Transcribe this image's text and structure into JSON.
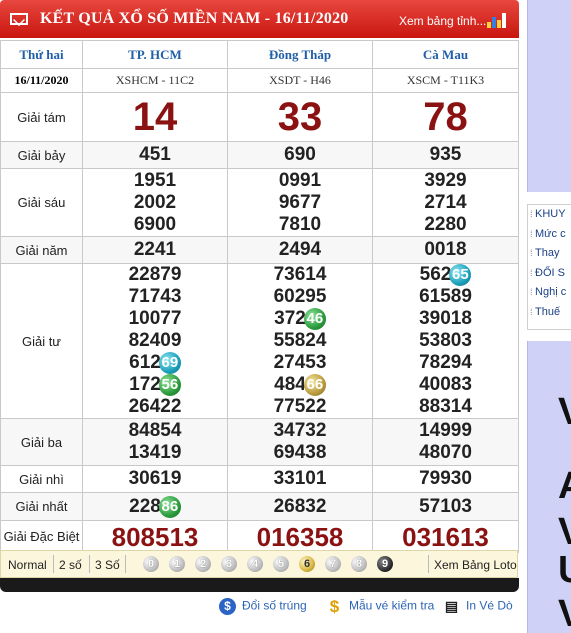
{
  "header": {
    "title": "KẾT QUẢ XỔ SỐ MIỀN NAM - 16/11/2020",
    "view_link": "Xem bảng tỉnh...",
    "mail_icon": "envelope-icon",
    "chart_icon": "bar-chart-icon",
    "colors": {
      "bar": "#d7261d",
      "title_text": "#ffffff"
    }
  },
  "table": {
    "day": "Thứ hai",
    "date": "16/11/2020",
    "provinces": [
      {
        "name": "TP. HCM",
        "code": "XSHCM - 11C2"
      },
      {
        "name": "Đồng Tháp",
        "code": "XSDT - H46"
      },
      {
        "name": "Cà Mau",
        "code": "XSCM - T11K3"
      }
    ],
    "prizes": {
      "g8": {
        "label": "Giải tám",
        "values": [
          "14",
          "33",
          "78"
        ]
      },
      "g7": {
        "label": "Giải bảy",
        "values": [
          "451",
          "690",
          "935"
        ]
      },
      "g6": {
        "label": "Giải sáu",
        "values": [
          [
            "1951",
            "2002",
            "6900"
          ],
          [
            "0991",
            "9677",
            "7810"
          ],
          [
            "3929",
            "2714",
            "2280"
          ]
        ]
      },
      "g5": {
        "label": "Giải năm",
        "values": [
          "2241",
          "2494",
          "0018"
        ]
      },
      "g4": {
        "label": "Giải tư",
        "values": [
          [
            [
              "22879",
              ""
            ],
            [
              "71743",
              ""
            ],
            [
              "10077",
              ""
            ],
            [
              "82409",
              ""
            ],
            [
              "612",
              "69"
            ],
            [
              "172",
              "56"
            ],
            [
              "26422",
              ""
            ]
          ],
          [
            [
              "73614",
              ""
            ],
            [
              "60295",
              ""
            ],
            [
              "372",
              "46"
            ],
            [
              "55824",
              ""
            ],
            [
              "27453",
              ""
            ],
            [
              "484",
              "66"
            ],
            [
              "77522",
              ""
            ]
          ],
          [
            [
              "562",
              "65"
            ],
            [
              "61589",
              ""
            ],
            [
              "39018",
              ""
            ],
            [
              "53803",
              ""
            ],
            [
              "78294",
              ""
            ],
            [
              "40083",
              ""
            ],
            [
              "88314",
              ""
            ]
          ]
        ]
      },
      "g3": {
        "label": "Giải ba",
        "values": [
          [
            "84854",
            "13419"
          ],
          [
            "34732",
            "69438"
          ],
          [
            "14999",
            "48070"
          ]
        ]
      },
      "g2": {
        "label": "Giải nhì",
        "values": [
          "30619",
          "33101",
          "79930"
        ]
      },
      "g1": {
        "label": "Giải nhất",
        "values": [
          [
            "228",
            "86"
          ],
          [
            "26832",
            ""
          ],
          [
            "57103",
            ""
          ]
        ]
      },
      "db": {
        "label": "Giải Đặc Biệt",
        "values": [
          "808513",
          "016358",
          "031613"
        ]
      }
    },
    "colors": {
      "province_text": "#2160a8",
      "special_text": "#8b1212"
    }
  },
  "footer": {
    "modes": [
      "Normal",
      "2 số",
      "3 Số"
    ],
    "digits": [
      "0",
      "1",
      "2",
      "3",
      "4",
      "5",
      "6",
      "7",
      "8",
      "9"
    ],
    "selected_digit": "6",
    "loto_link": "Xem Bảng Loto"
  },
  "links": {
    "doi_so": "Đổi số trúng",
    "mau_ve": "Mẫu vé kiểm tra",
    "in_ve": "In Vé Dò"
  },
  "sidebar": {
    "items": [
      "KHUY",
      "Mức c",
      "Thay",
      "ĐỔI S",
      "Nghị c",
      "Thuế"
    ],
    "banner_text": [
      "V",
      "A",
      "V",
      "U",
      "V"
    ]
  }
}
